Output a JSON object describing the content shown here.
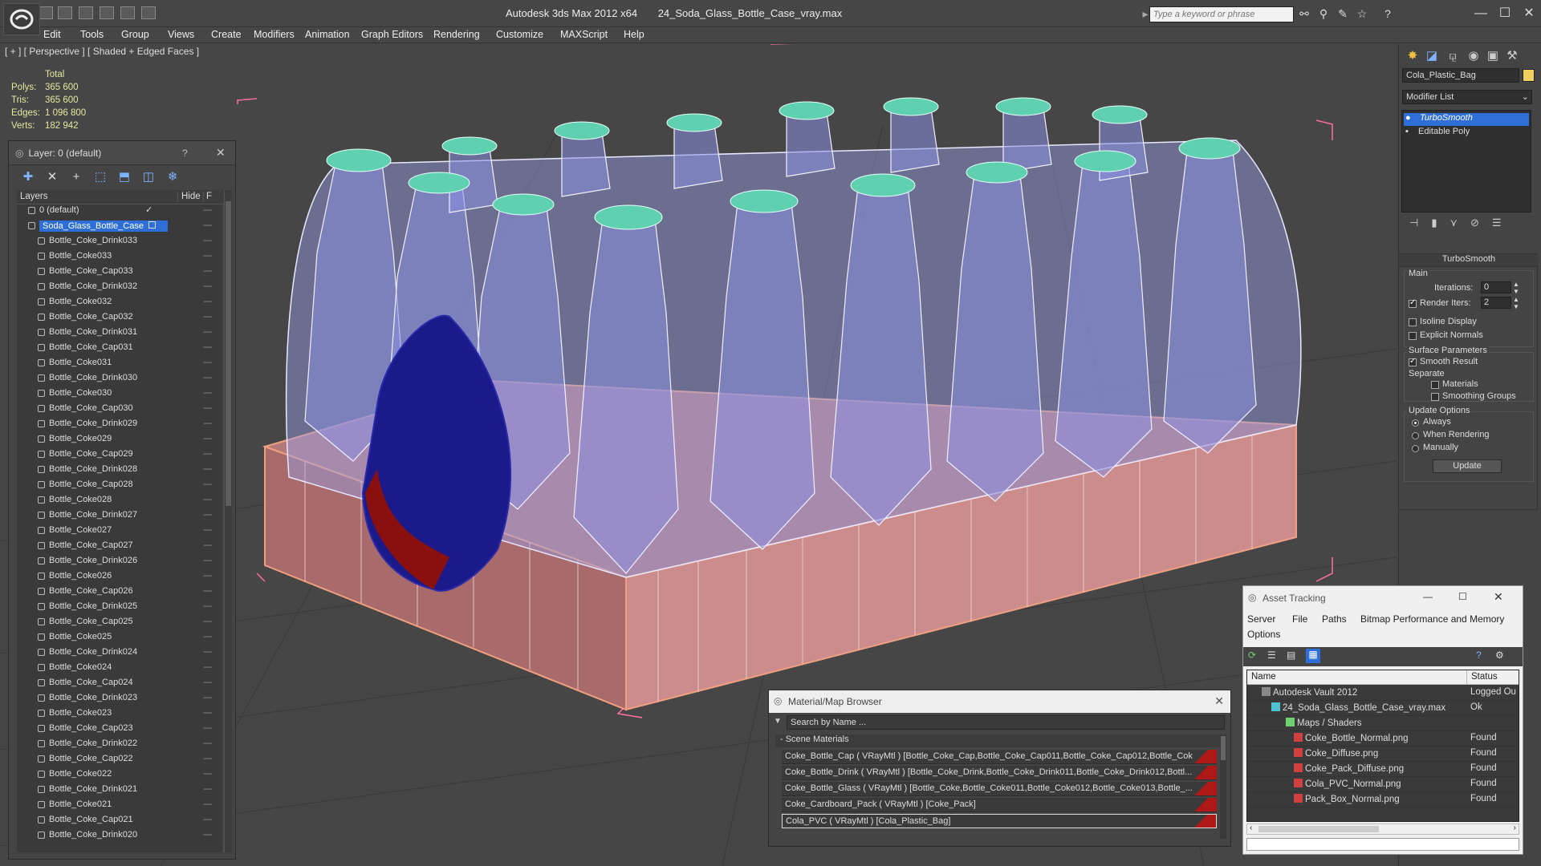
{
  "titlebar": {
    "app": "Autodesk 3ds Max  2012 x64",
    "file": "24_Soda_Glass_Bottle_Case_vray.max",
    "search_placeholder": "Type a keyword or phrase",
    "icons": [
      "binoculars-icon",
      "search-icon",
      "star-icon",
      "help-icon"
    ],
    "window_buttons": [
      "—",
      "☐",
      "✕"
    ]
  },
  "menu": [
    "Edit",
    "Tools",
    "Group",
    "Views",
    "Create",
    "Modifiers",
    "Animation",
    "Graph Editors",
    "Rendering",
    "Customize",
    "MAXScript",
    "Help"
  ],
  "viewport": {
    "label": "[ + ] [ Perspective ] [ Shaded + Edged Faces ]",
    "stats": {
      "header": "Total",
      "rows": [
        {
          "k": "Polys:",
          "v": "365 600"
        },
        {
          "k": "Tris:",
          "v": "365 600"
        },
        {
          "k": "Edges:",
          "v": "1 096 800"
        },
        {
          "k": "Verts:",
          "v": "182 942"
        }
      ]
    }
  },
  "layer_dialog": {
    "title": "Layer: 0 (default)",
    "help": "?",
    "close": "✕",
    "col_layers": "Layers",
    "col_hide": "Hide",
    "col_f": "F",
    "rows": [
      "0 (default)",
      "Soda_Glass_Bottle_Case",
      "Bottle_Coke_Drink033",
      "Bottle_Coke033",
      "Bottle_Coke_Cap033",
      "Bottle_Coke_Drink032",
      "Bottle_Coke032",
      "Bottle_Coke_Cap032",
      "Bottle_Coke_Drink031",
      "Bottle_Coke_Cap031",
      "Bottle_Coke031",
      "Bottle_Coke_Drink030",
      "Bottle_Coke030",
      "Bottle_Coke_Cap030",
      "Bottle_Coke_Drink029",
      "Bottle_Coke029",
      "Bottle_Coke_Cap029",
      "Bottle_Coke_Drink028",
      "Bottle_Coke_Cap028",
      "Bottle_Coke028",
      "Bottle_Coke_Drink027",
      "Bottle_Coke027",
      "Bottle_Coke_Cap027",
      "Bottle_Coke_Drink026",
      "Bottle_Coke026",
      "Bottle_Coke_Cap026",
      "Bottle_Coke_Drink025",
      "Bottle_Coke_Cap025",
      "Bottle_Coke025",
      "Bottle_Coke_Drink024",
      "Bottle_Coke024",
      "Bottle_Coke_Cap024",
      "Bottle_Coke_Drink023",
      "Bottle_Coke023",
      "Bottle_Coke_Cap023",
      "Bottle_Coke_Drink022",
      "Bottle_Coke_Cap022",
      "Bottle_Coke022",
      "Bottle_Coke_Drink021",
      "Bottle_Coke021",
      "Bottle_Coke_Cap021",
      "Bottle_Coke_Drink020"
    ]
  },
  "command_panel": {
    "object_name": "Cola_Plastic_Bag",
    "modifier_list": "Modifier List",
    "stack": [
      "TurboSmooth",
      "Editable Poly"
    ],
    "turbosmooth": {
      "title": "TurboSmooth",
      "main": "Main",
      "iterations_label": "Iterations:",
      "iterations": "0",
      "render_iters_label": "Render Iters:",
      "render_iters": "2",
      "isoline": "Isoline Display",
      "explicit": "Explicit Normals",
      "surface": "Surface Parameters",
      "smooth_result": "Smooth Result",
      "separate": "Separate",
      "materials": "Materials",
      "smoothing_groups": "Smoothing Groups",
      "update_options": "Update Options",
      "always": "Always",
      "when_rendering": "When Rendering",
      "manually": "Manually",
      "update_btn": "Update"
    }
  },
  "material_browser": {
    "title": "Material/Map Browser",
    "search_placeholder": "Search by Name ...",
    "section": "- Scene Materials",
    "rows": [
      "Coke_Bottle_Cap ( VRayMtl ) [Bottle_Coke_Cap,Bottle_Coke_Cap011,Bottle_Coke_Cap012,Bottle_Cok...",
      "Coke_Bottle_Drink ( VRayMtl ) [Bottle_Coke_Drink,Bottle_Coke_Drink011,Bottle_Coke_Drink012,Bottl...",
      "Coke_Bottle_Glass ( VRayMtl ) [Bottle_Coke,Bottle_Coke011,Bottle_Coke012,Bottle_Coke013,Bottle_...",
      "Coke_Cardboard_Pack  ( VRayMtl ) [Coke_Pack]",
      "Cola_PVC  ( VRayMtl ) [Cola_Plastic_Bag]"
    ]
  },
  "asset_tracking": {
    "title": "Asset Tracking",
    "menu": [
      "Server",
      "File",
      "Paths",
      "Bitmap Performance and Memory",
      "Options"
    ],
    "col_name": "Name",
    "col_status": "Status",
    "rows": [
      {
        "name": "Autodesk Vault 2012",
        "status": "Logged Ou"
      },
      {
        "name": "24_Soda_Glass_Bottle_Case_vray.max",
        "status": "Ok"
      },
      {
        "name": "Maps / Shaders",
        "status": ""
      },
      {
        "name": "Coke_Bottle_Normal.png",
        "status": "Found"
      },
      {
        "name": "Coke_Diffuse.png",
        "status": "Found"
      },
      {
        "name": "Coke_Pack_Diffuse.png",
        "status": "Found"
      },
      {
        "name": "Cola_PVC_Normal.png",
        "status": "Found"
      },
      {
        "name": "Pack_Box_Normal.png",
        "status": "Found"
      }
    ]
  },
  "colors": {
    "selection": "#2d6fd6",
    "stats_text": "#e8e8a0",
    "box_fill": "#c98585",
    "wire_blue": "#9aa0e8",
    "cap_teal": "#5fd0b0",
    "selection_box": "#ff6699"
  }
}
